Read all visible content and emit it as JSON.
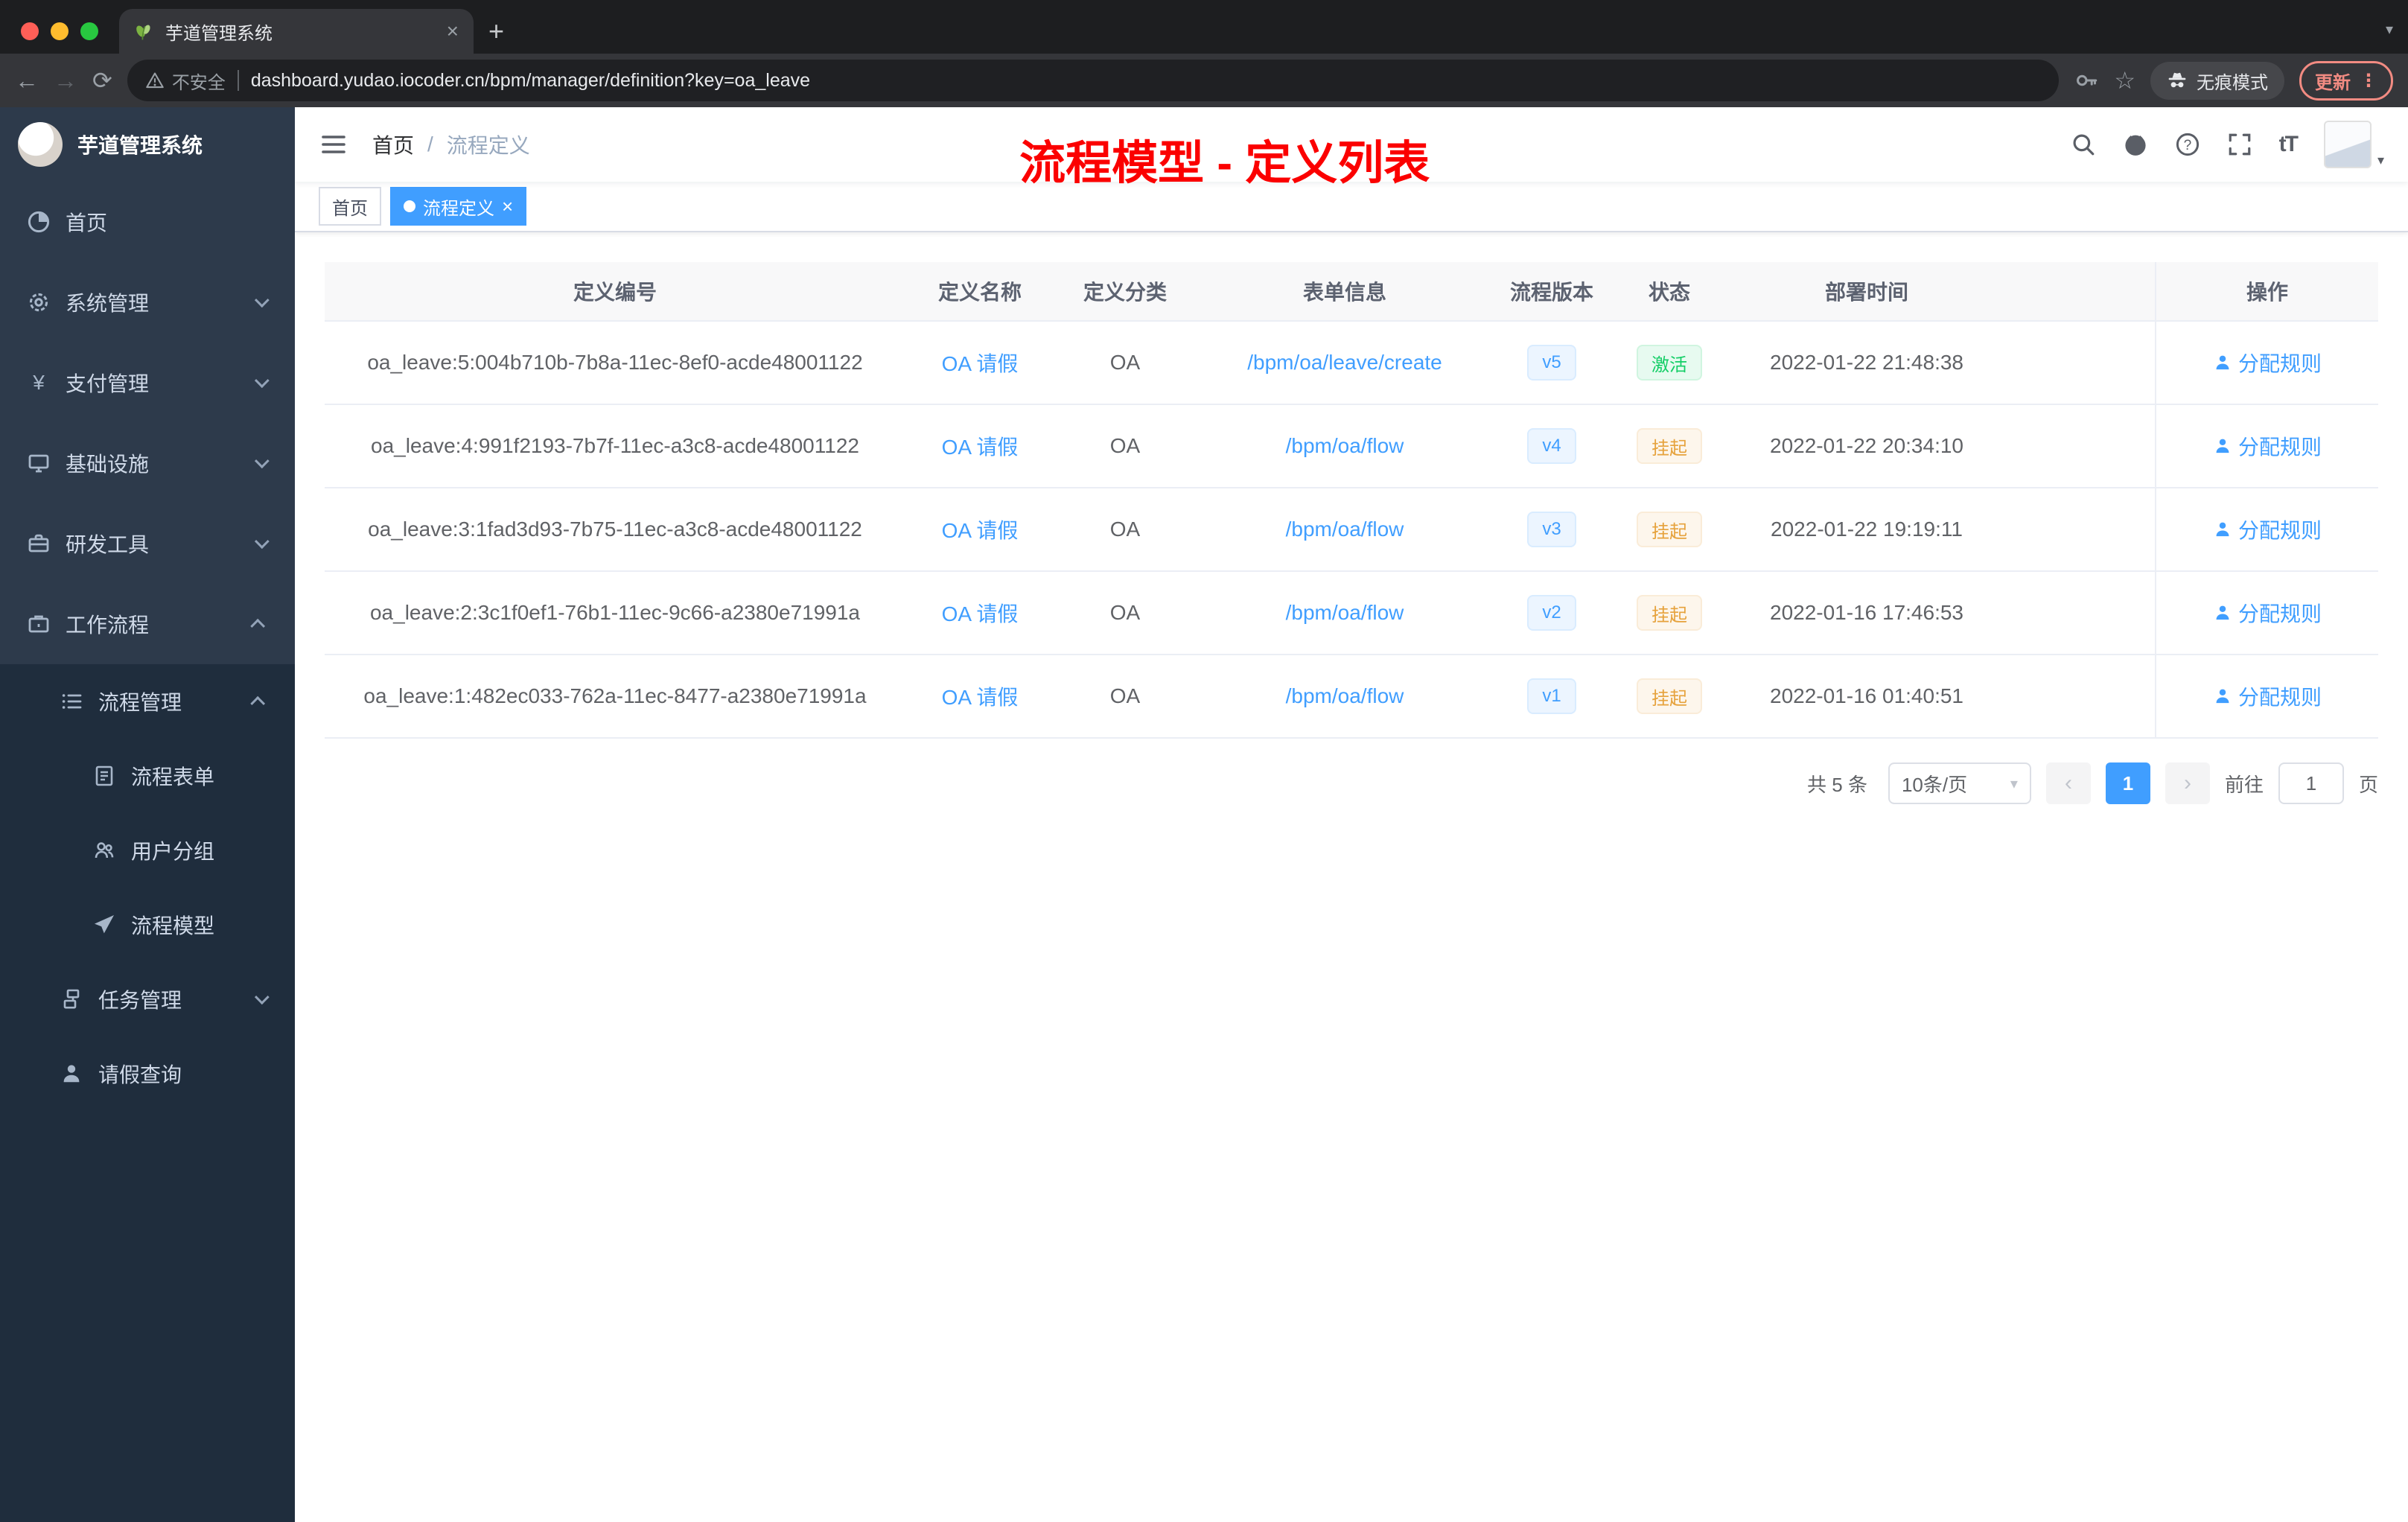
{
  "colors": {
    "accent": "#409eff",
    "success": "#13ce66",
    "warning": "#e6a23c",
    "annotation_red": "#fb0000",
    "sidebar_bg": "#2d3a4b",
    "submenu_bg": "#1f2d3d"
  },
  "browser": {
    "tab_title": "芋道管理系统",
    "security_label": "不安全",
    "url": "dashboard.yudao.iocoder.cn/bpm/manager/definition?key=oa_leave",
    "incognito_label": "无痕模式",
    "update_label": "更新"
  },
  "glyphs": {
    "back": "←",
    "forward": "→",
    "reload": "⟳",
    "star": "☆",
    "dots": "⋮",
    "plus": "+",
    "close": "×",
    "caret_down": "▾",
    "breadcrumb_sep": "/",
    "text_size": "tT",
    "prev": "‹",
    "next": "›",
    "yen": "¥",
    "tag_close": "×"
  },
  "sidebar": {
    "brand": "芋道管理系统",
    "menu": [
      {
        "label": "首页"
      },
      {
        "label": "系统管理"
      },
      {
        "label": "支付管理"
      },
      {
        "label": "基础设施"
      },
      {
        "label": "研发工具"
      },
      {
        "label": "工作流程"
      }
    ],
    "submenu": [
      {
        "label": "流程管理"
      },
      {
        "label": "流程表单"
      },
      {
        "label": "用户分组"
      },
      {
        "label": "流程模型"
      },
      {
        "label": "任务管理"
      },
      {
        "label": "请假查询"
      }
    ]
  },
  "navbar": {
    "breadcrumb": [
      "首页",
      "流程定义"
    ]
  },
  "annotation": "流程模型 - 定义列表",
  "tags": [
    {
      "label": "首页"
    },
    {
      "label": "流程定义"
    }
  ],
  "table": {
    "headers": [
      "定义编号",
      "定义名称",
      "定义分类",
      "表单信息",
      "流程版本",
      "状态",
      "部署时间",
      "操作"
    ],
    "rows": [
      {
        "id": "oa_leave:5:004b710b-7b8a-11ec-8ef0-acde48001122",
        "name": "OA 请假",
        "category": "OA",
        "form": "/bpm/oa/leave/create",
        "version": "v5",
        "status": "激活",
        "status_type": "success",
        "time": "2022-01-22 21:48:38",
        "action": "分配规则"
      },
      {
        "id": "oa_leave:4:991f2193-7b7f-11ec-a3c8-acde48001122",
        "name": "OA 请假",
        "category": "OA",
        "form": "/bpm/oa/flow",
        "version": "v4",
        "status": "挂起",
        "status_type": "warning",
        "time": "2022-01-22 20:34:10",
        "action": "分配规则"
      },
      {
        "id": "oa_leave:3:1fad3d93-7b75-11ec-a3c8-acde48001122",
        "name": "OA 请假",
        "category": "OA",
        "form": "/bpm/oa/flow",
        "version": "v3",
        "status": "挂起",
        "status_type": "warning",
        "time": "2022-01-22 19:19:11",
        "action": "分配规则"
      },
      {
        "id": "oa_leave:2:3c1f0ef1-76b1-11ec-9c66-a2380e71991a",
        "name": "OA 请假",
        "category": "OA",
        "form": "/bpm/oa/flow",
        "version": "v2",
        "status": "挂起",
        "status_type": "warning",
        "time": "2022-01-16 17:46:53",
        "action": "分配规则"
      },
      {
        "id": "oa_leave:1:482ec033-762a-11ec-8477-a2380e71991a",
        "name": "OA 请假",
        "category": "OA",
        "form": "/bpm/oa/flow",
        "version": "v1",
        "status": "挂起",
        "status_type": "warning",
        "time": "2022-01-16 01:40:51",
        "action": "分配规则"
      }
    ]
  },
  "pagination": {
    "total": "共 5 条",
    "page_size": "10条/页",
    "page": "1",
    "goto_label": "前往",
    "goto_value": "1",
    "goto_unit": "页"
  }
}
